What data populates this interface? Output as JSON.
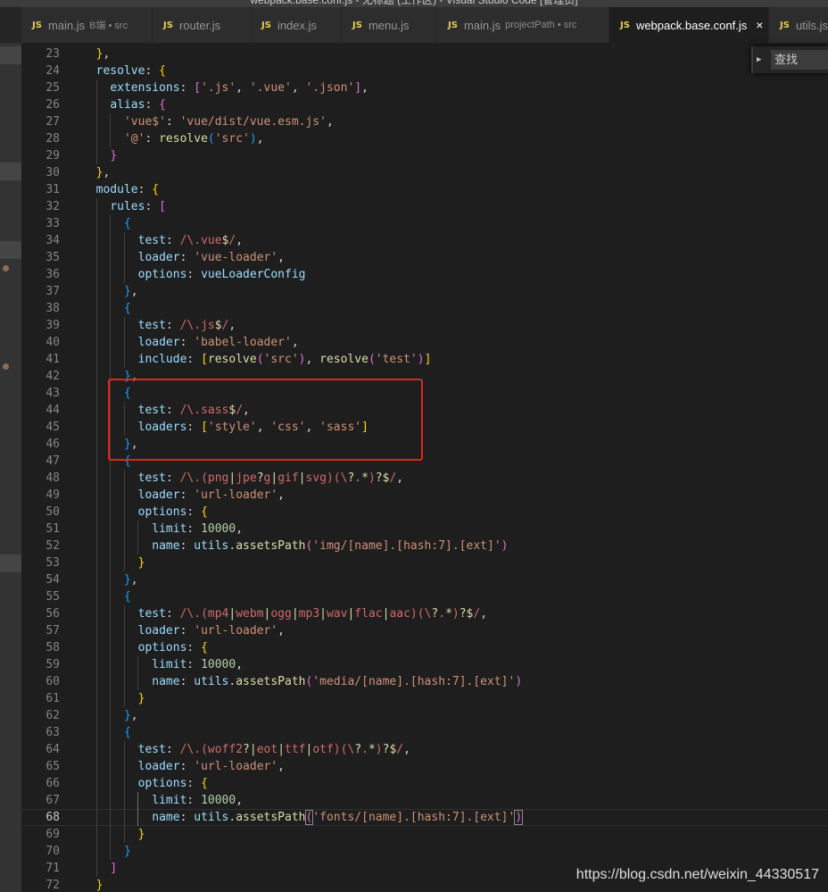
{
  "window": {
    "title": "webpack.base.conf.js - 无标题 (工作区) - Visual Studio Code [管理员]"
  },
  "tabs": [
    {
      "icon": "JS",
      "label": "main.js",
      "desc": "B端 • src",
      "active": false
    },
    {
      "icon": "JS",
      "label": "router.js",
      "desc": "",
      "active": false
    },
    {
      "icon": "JS",
      "label": "index.js",
      "desc": "",
      "active": false
    },
    {
      "icon": "JS",
      "label": "menu.js",
      "desc": "",
      "active": false
    },
    {
      "icon": "JS",
      "label": "main.js",
      "desc": "projectPath • src",
      "active": false
    },
    {
      "icon": "JS",
      "label": "webpack.base.conf.js",
      "desc": "",
      "active": true,
      "close": "×"
    },
    {
      "icon": "JS",
      "label": "utils.js",
      "desc": "",
      "active": false
    }
  ],
  "find": {
    "placeholder": "查找",
    "toggle": "▶"
  },
  "watermark": "https://blog.csdn.net/weixin_44330517",
  "colors": {
    "highlight_box": "#e0241b",
    "editor_bg": "#1e1e1e"
  },
  "editor": {
    "current_line": 68,
    "lines": [
      {
        "n": "23",
        "t": "  },"
      },
      {
        "n": "24",
        "t": "  resolve: {"
      },
      {
        "n": "25",
        "t": "    extensions: ['.js', '.vue', '.json'],"
      },
      {
        "n": "26",
        "t": "    alias: {"
      },
      {
        "n": "27",
        "t": "      'vue$': 'vue/dist/vue.esm.js',"
      },
      {
        "n": "28",
        "t": "      '@': resolve('src'),"
      },
      {
        "n": "29",
        "t": "    }"
      },
      {
        "n": "30",
        "t": "  },"
      },
      {
        "n": "31",
        "t": "  module: {"
      },
      {
        "n": "32",
        "t": "    rules: ["
      },
      {
        "n": "33",
        "t": "      {"
      },
      {
        "n": "34",
        "t": "        test: /\\.vue$/,"
      },
      {
        "n": "35",
        "t": "        loader: 'vue-loader',"
      },
      {
        "n": "36",
        "t": "        options: vueLoaderConfig"
      },
      {
        "n": "37",
        "t": "      },"
      },
      {
        "n": "38",
        "t": "      {"
      },
      {
        "n": "39",
        "t": "        test: /\\.js$/,"
      },
      {
        "n": "40",
        "t": "        loader: 'babel-loader',"
      },
      {
        "n": "41",
        "t": "        include: [resolve('src'), resolve('test')]"
      },
      {
        "n": "42",
        "t": "      },"
      },
      {
        "n": "43",
        "t": "      {"
      },
      {
        "n": "44",
        "t": "        test: /\\.sass$/,"
      },
      {
        "n": "45",
        "t": "        loaders: ['style', 'css', 'sass']"
      },
      {
        "n": "46",
        "t": "      },"
      },
      {
        "n": "47",
        "t": "      {"
      },
      {
        "n": "48",
        "t": "        test: /\\.(png|jpe?g|gif|svg)(\\?.*)?$/,"
      },
      {
        "n": "49",
        "t": "        loader: 'url-loader',"
      },
      {
        "n": "50",
        "t": "        options: {"
      },
      {
        "n": "51",
        "t": "          limit: 10000,"
      },
      {
        "n": "52",
        "t": "          name: utils.assetsPath('img/[name].[hash:7].[ext]')"
      },
      {
        "n": "53",
        "t": "        }"
      },
      {
        "n": "54",
        "t": "      },"
      },
      {
        "n": "55",
        "t": "      {"
      },
      {
        "n": "56",
        "t": "        test: /\\.(mp4|webm|ogg|mp3|wav|flac|aac)(\\?.*)?$/,"
      },
      {
        "n": "57",
        "t": "        loader: 'url-loader',"
      },
      {
        "n": "58",
        "t": "        options: {"
      },
      {
        "n": "59",
        "t": "          limit: 10000,"
      },
      {
        "n": "60",
        "t": "          name: utils.assetsPath('media/[name].[hash:7].[ext]')"
      },
      {
        "n": "61",
        "t": "        }"
      },
      {
        "n": "62",
        "t": "      },"
      },
      {
        "n": "63",
        "t": "      {"
      },
      {
        "n": "64",
        "t": "        test: /\\.(woff2?|eot|ttf|otf)(\\?.*)?$/,"
      },
      {
        "n": "65",
        "t": "        loader: 'url-loader',"
      },
      {
        "n": "66",
        "t": "        options: {"
      },
      {
        "n": "67",
        "t": "          limit: 10000,"
      },
      {
        "n": "68",
        "t": "          name: utils.assetsPath('fonts/[name].[hash:7].[ext]')"
      },
      {
        "n": "69",
        "t": "        }"
      },
      {
        "n": "70",
        "t": "      }"
      },
      {
        "n": "71",
        "t": "    ]"
      },
      {
        "n": "72",
        "t": "  }"
      }
    ]
  }
}
